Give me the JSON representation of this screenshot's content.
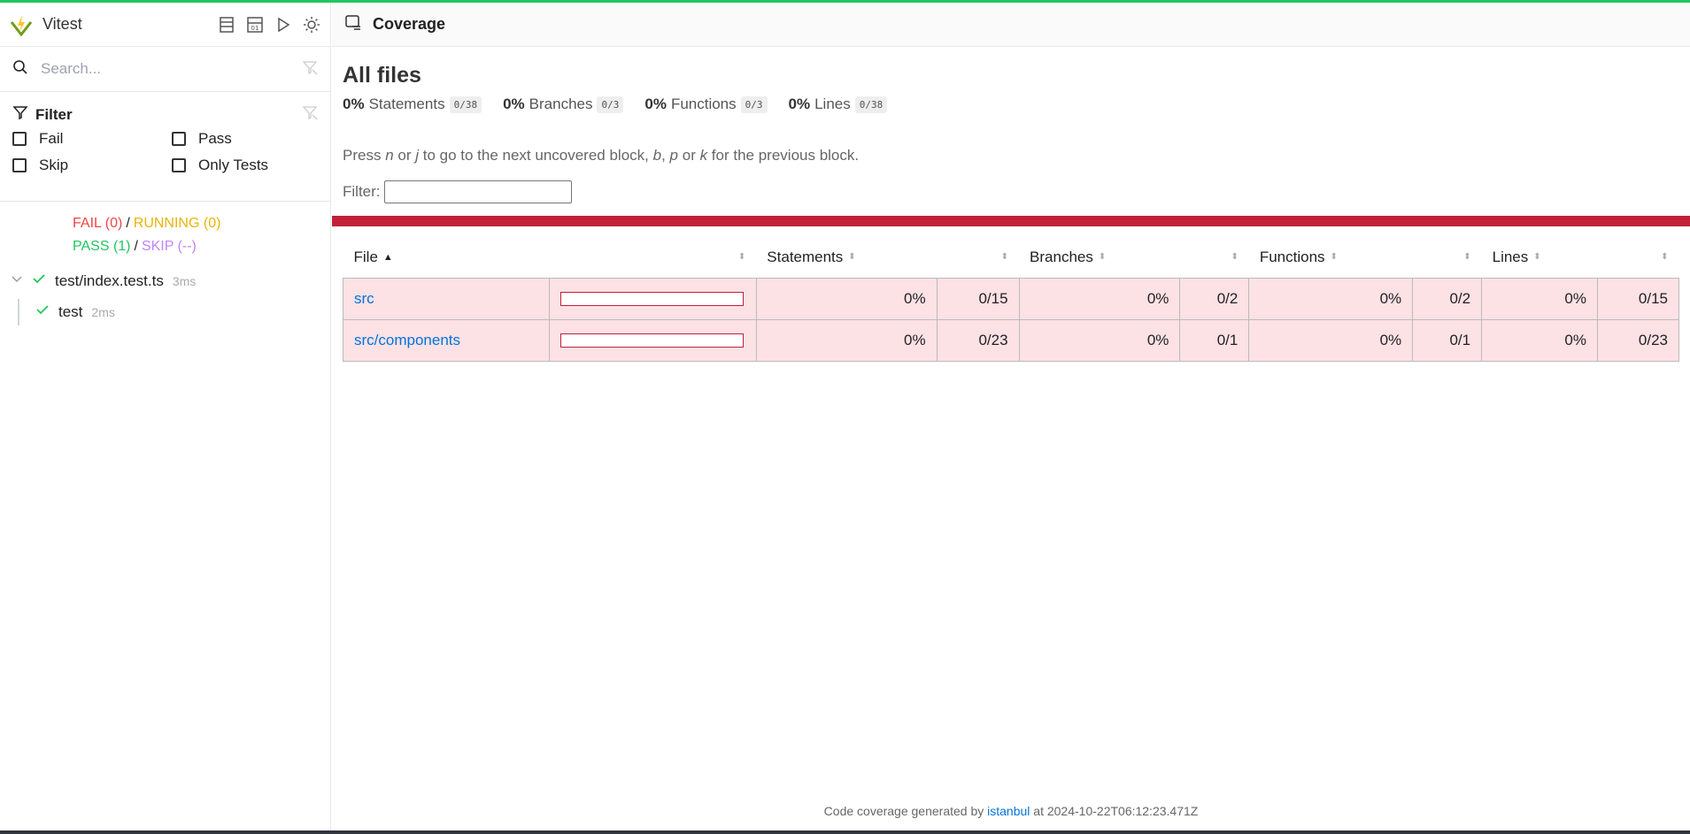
{
  "sidebar": {
    "app_title": "Vitest",
    "search_placeholder": "Search...",
    "filter_title": "Filter",
    "filters": [
      {
        "label": "Fail"
      },
      {
        "label": "Pass"
      },
      {
        "label": "Skip"
      },
      {
        "label": "Only Tests"
      }
    ],
    "status": {
      "fail": "FAIL (0)",
      "running": "RUNNING (0)",
      "pass": "PASS (1)",
      "skip": "SKIP (--)",
      "separator": "/"
    },
    "tree": [
      {
        "name": "test/index.test.ts",
        "duration": "3ms"
      },
      {
        "name": "test",
        "duration": "2ms"
      }
    ]
  },
  "main": {
    "title": "Coverage",
    "heading": "All files",
    "summary": [
      {
        "pct": "0%",
        "label": "Statements",
        "fraction": "0/38"
      },
      {
        "pct": "0%",
        "label": "Branches",
        "fraction": "0/3"
      },
      {
        "pct": "0%",
        "label": "Functions",
        "fraction": "0/3"
      },
      {
        "pct": "0%",
        "label": "Lines",
        "fraction": "0/38"
      }
    ],
    "hint": {
      "p1": "Press ",
      "n": "n",
      "or1": " or ",
      "j": "j",
      "p2": " to go to the next uncovered block, ",
      "b": "b",
      "comma": ", ",
      "p": "p",
      "or2": " or ",
      "k": "k",
      "p3": " for the previous block."
    },
    "filter_label": "Filter:",
    "table": {
      "headers": [
        "File",
        "Statements",
        "Branches",
        "Functions",
        "Lines"
      ],
      "rows": [
        {
          "file": "src",
          "stmt_pct": "0%",
          "stmt_frac": "0/15",
          "br_pct": "0%",
          "br_frac": "0/2",
          "fn_pct": "0%",
          "fn_frac": "0/2",
          "ln_pct": "0%",
          "ln_frac": "0/15",
          "coverage": 0
        },
        {
          "file": "src/components",
          "stmt_pct": "0%",
          "stmt_frac": "0/23",
          "br_pct": "0%",
          "br_frac": "0/1",
          "fn_pct": "0%",
          "fn_frac": "0/1",
          "ln_pct": "0%",
          "ln_frac": "0/23",
          "coverage": 0
        }
      ]
    },
    "footer": {
      "prefix": "Code coverage generated by ",
      "link": "istanbul",
      "suffix": " at 2024-10-22T06:12:23.471Z"
    }
  },
  "colors": {
    "accent_green": "#22c55e",
    "low_coverage_red": "#c21f39",
    "row_bg": "#fce1e5",
    "link": "#0074d9"
  }
}
